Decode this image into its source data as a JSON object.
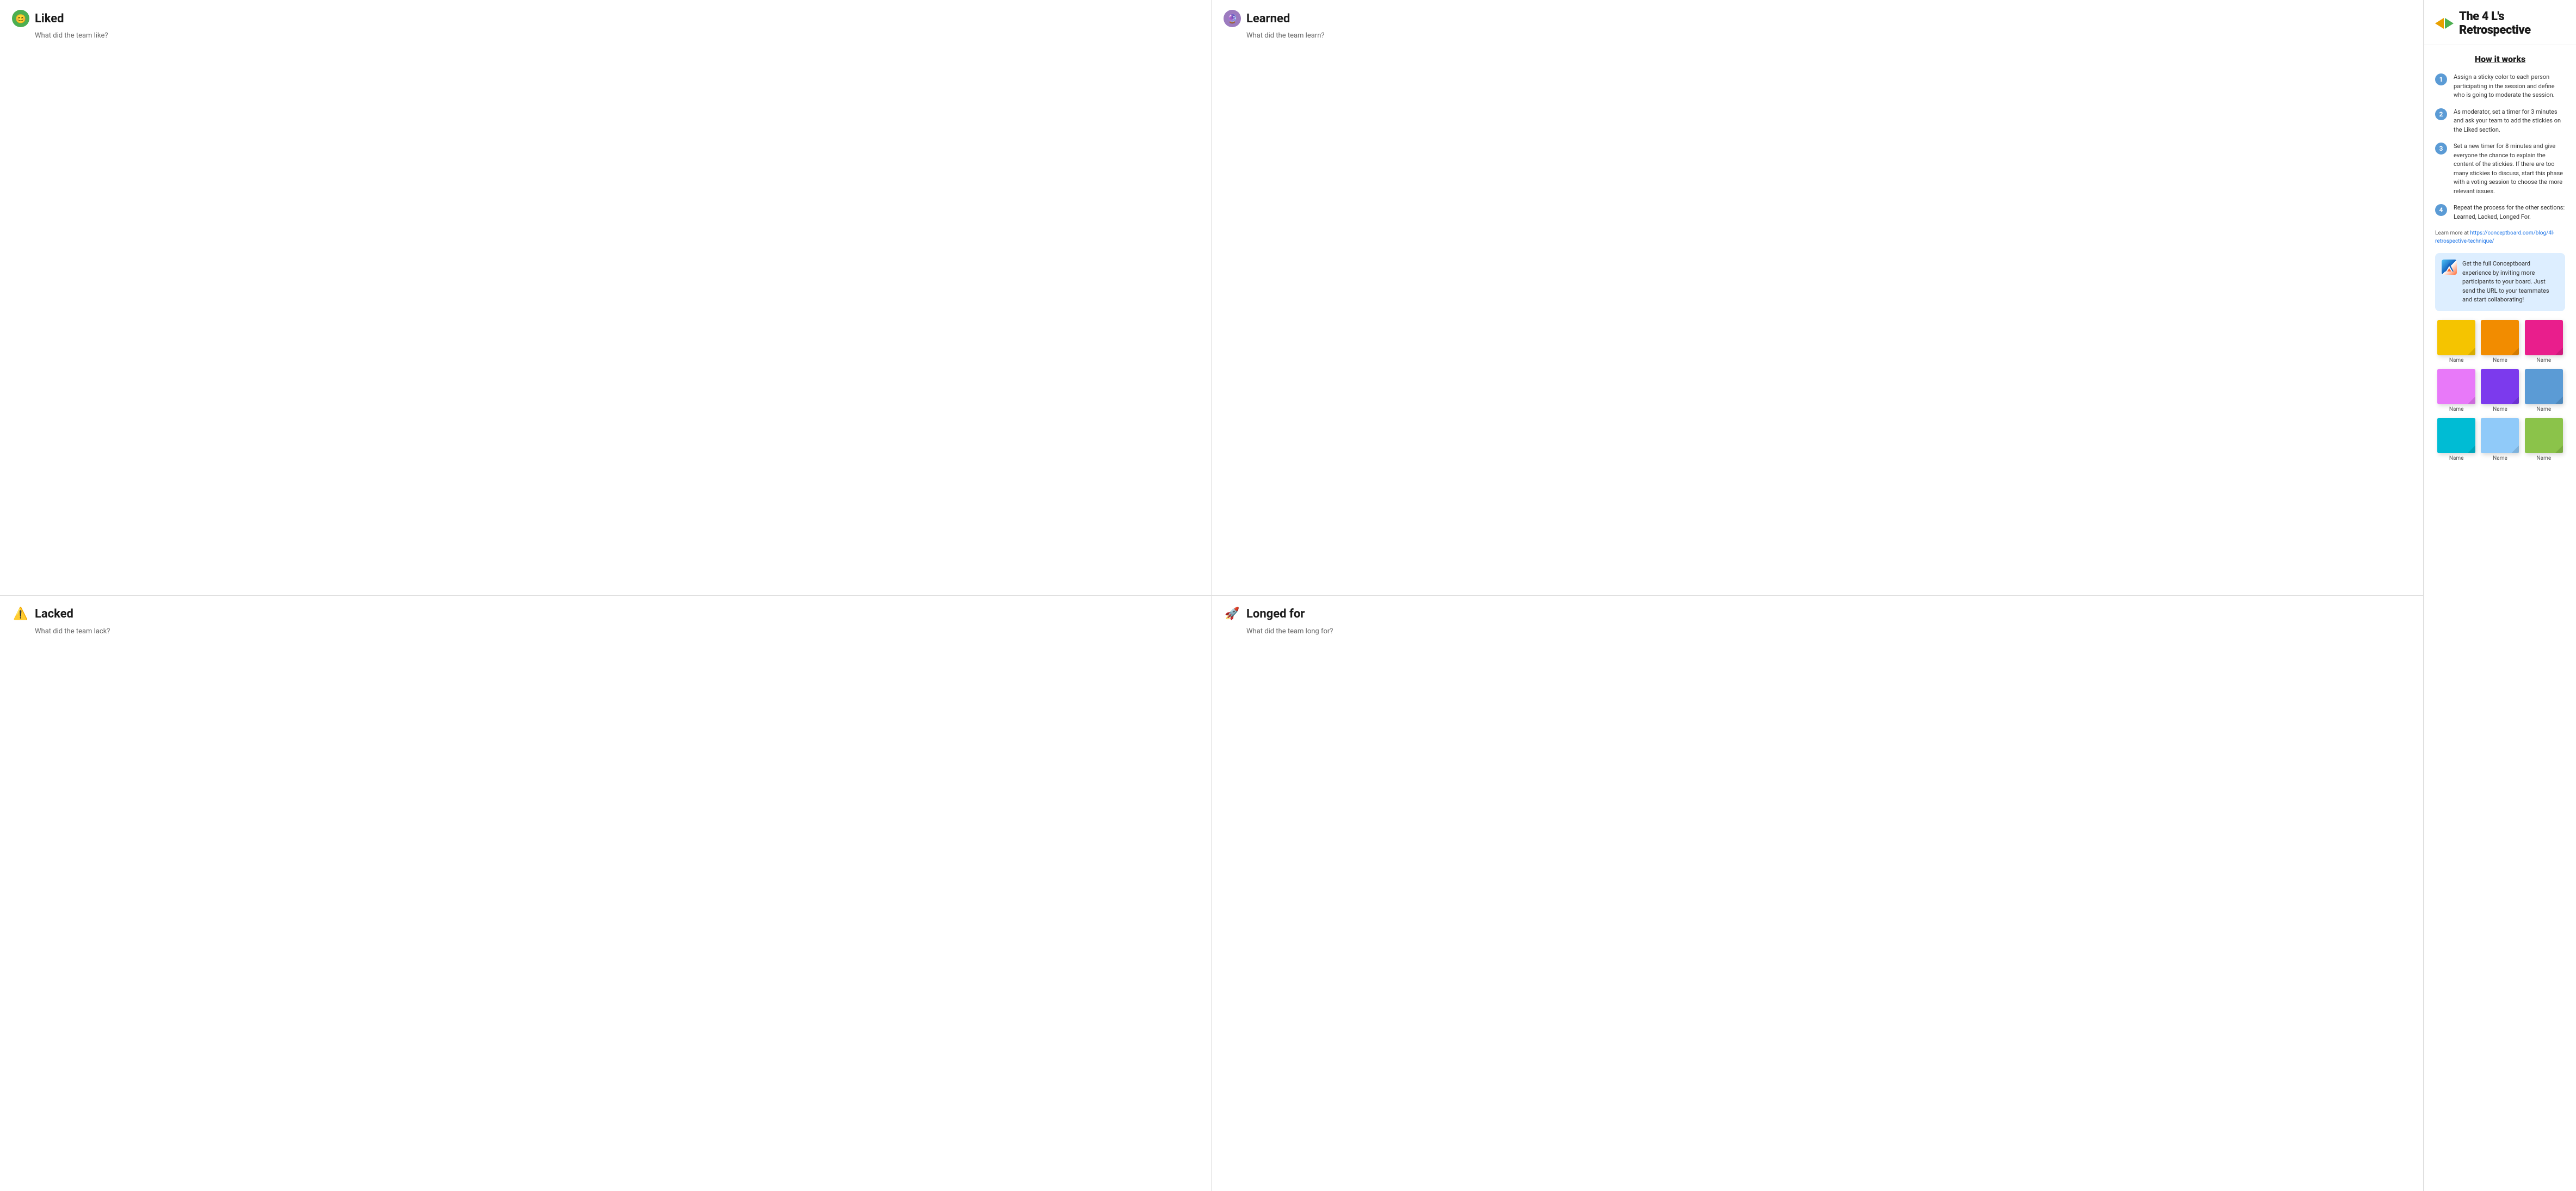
{
  "title": "The 4 L's Retrospective",
  "quadrants": [
    {
      "id": "liked",
      "title": "Liked",
      "subtitle": "What did the team like?",
      "icon": "😊",
      "iconStyle": "liked"
    },
    {
      "id": "learned",
      "title": "Learned",
      "subtitle": "What did the team learn?",
      "icon": "🔮",
      "iconStyle": "learned"
    },
    {
      "id": "lacked",
      "title": "Lacked",
      "subtitle": "What did the team lack?",
      "icon": "⚠️",
      "iconStyle": "lacked"
    },
    {
      "id": "longed",
      "title": "Longed for",
      "subtitle": "What did the team long for?",
      "icon": "🚀",
      "iconStyle": "longed"
    }
  ],
  "sidebar": {
    "title": "The 4 L's Retrospective",
    "how_it_works": "How it works",
    "steps": [
      {
        "number": "1",
        "text": "Assign a sticky color to each person participating in the session and define who is going to moderate the session."
      },
      {
        "number": "2",
        "text": "As moderator, set a timer for 3 minutes and ask your team to add the stickies on the Liked section."
      },
      {
        "number": "3",
        "text": "Set a new timer for 8 minutes and give everyone the chance to explain the content of the stickies. If there are too many stickies to discuss, start this phase with a voting session to choose the more relevant issues."
      },
      {
        "number": "4",
        "text": "Repeat the process for the other sections: Learned, Lacked, Longed For."
      }
    ],
    "learn_more_prefix": "Learn more at ",
    "learn_more_url": "https://conceptboard.com/blog/4l-retrospective-technique/",
    "learn_more_link_text": "https://conceptboard.com/blog/4l-retrospective-technique/",
    "invite_text": "Get the full Conceptboard experience by inviting more participants to your board. Just send the URL to your teammates and start collaborating!",
    "stickies": [
      {
        "color": "#f5c400",
        "label": "Name"
      },
      {
        "color": "#f28c00",
        "label": "Name"
      },
      {
        "color": "#e91e8c",
        "label": "Name"
      },
      {
        "color": "#e879f9",
        "label": "Name"
      },
      {
        "color": "#7c3aed",
        "label": "Name"
      },
      {
        "color": "#5b9bd5",
        "label": "Name"
      },
      {
        "color": "#00bcd4",
        "label": "Name"
      },
      {
        "color": "#90caf9",
        "label": "Name"
      },
      {
        "color": "#8bc34a",
        "label": "Name"
      }
    ]
  }
}
